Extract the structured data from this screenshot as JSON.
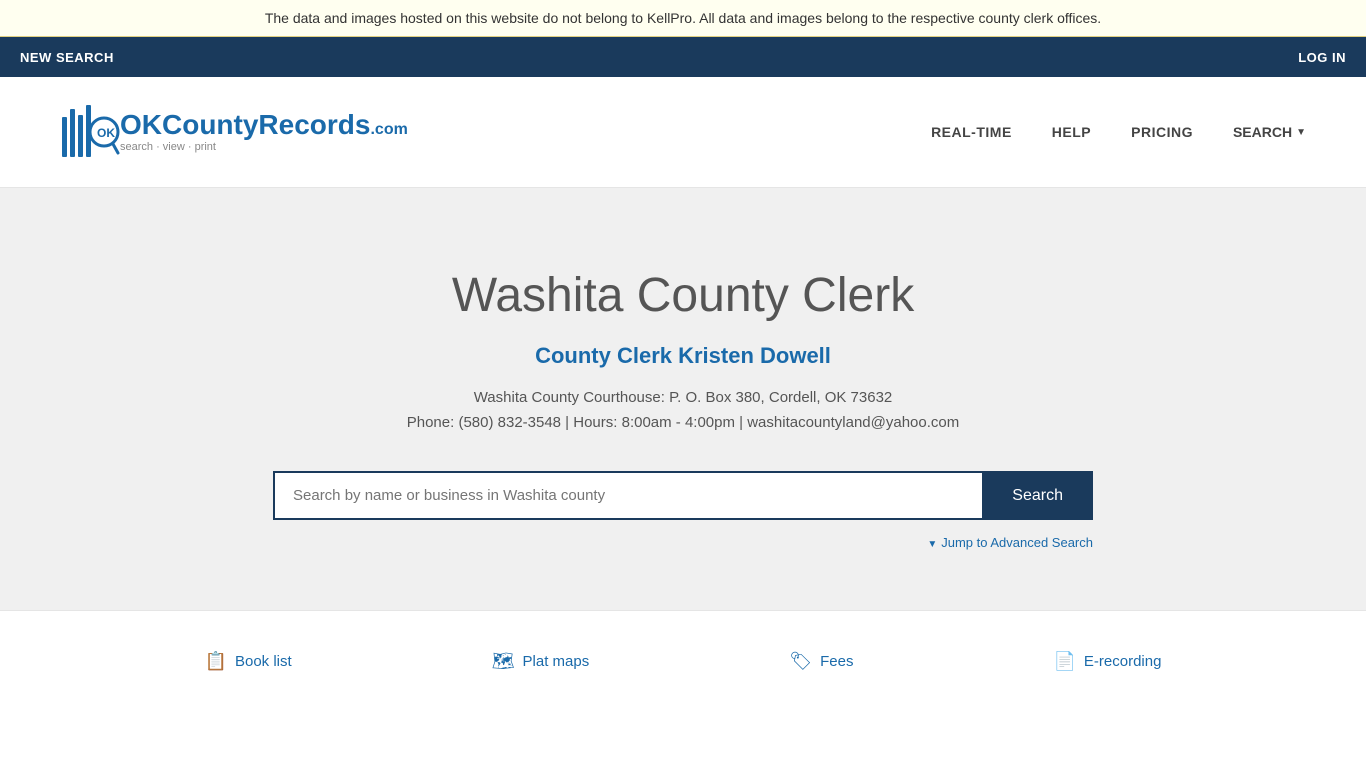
{
  "banner": {
    "text": "The data and images hosted on this website do not belong to KellPro. All data and images belong to the respective county clerk offices."
  },
  "top_nav": {
    "new_search": "NEW SEARCH",
    "log_in": "LOG IN"
  },
  "header": {
    "logo_brand": "OKCountyRecords",
    "logo_dot_com": ".com",
    "logo_tagline": "search · view · print",
    "nav": {
      "real_time": "REAL-TIME",
      "help": "HELP",
      "pricing": "PRICING",
      "search": "SEARCH"
    }
  },
  "hero": {
    "title": "Washita County Clerk",
    "clerk_name": "County Clerk Kristen Dowell",
    "address": "Washita County Courthouse: P. O. Box 380, Cordell, OK 73632",
    "phone_line": "Phone: (580) 832-3548 | Hours: 8:00am - 4:00pm | washitacountyland@yahoo.com",
    "search_placeholder": "Search by name or business in Washita county",
    "search_button": "Search",
    "advanced_search": "Jump to Advanced Search"
  },
  "footer": {
    "links": [
      {
        "label": "Book list",
        "icon": "📋"
      },
      {
        "label": "Plat maps",
        "icon": "🗺"
      },
      {
        "label": "Fees",
        "icon": "🏷"
      },
      {
        "label": "E-recording",
        "icon": "📄"
      }
    ]
  }
}
